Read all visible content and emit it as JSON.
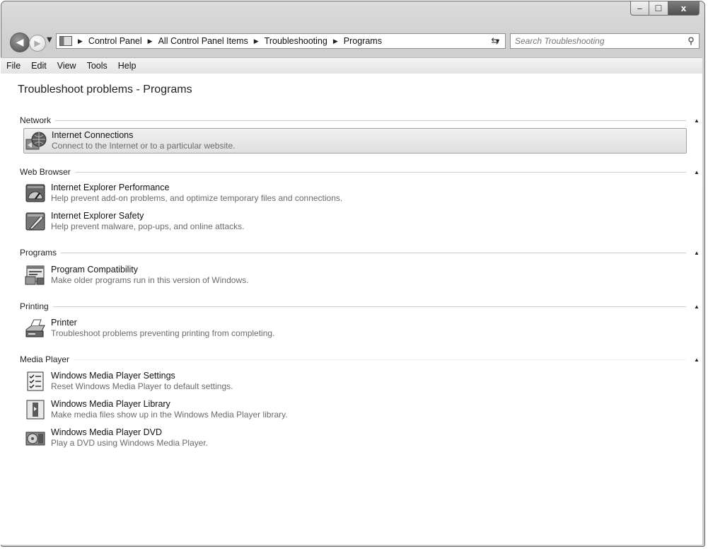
{
  "window": {
    "caption_buttons": {
      "minimize": "‒",
      "maximize": "☐",
      "close": "x"
    }
  },
  "address_bar": {
    "crumbs": [
      "Control Panel",
      "All Control Panel Items",
      "Troubleshooting",
      "Programs"
    ],
    "search_placeholder": "Search Troubleshooting"
  },
  "menu": [
    "File",
    "Edit",
    "View",
    "Tools",
    "Help"
  ],
  "page_title": "Troubleshoot problems - Programs",
  "groups": [
    {
      "name": "Network",
      "items": [
        {
          "title": "Internet Connections",
          "desc": "Connect to the Internet or to a particular website.",
          "icon": "network-globe-icon",
          "selected": true
        }
      ]
    },
    {
      "name": "Web Browser",
      "items": [
        {
          "title": "Internet Explorer Performance",
          "desc": "Help prevent add-on problems, and optimize temporary files and connections.",
          "icon": "ie-performance-icon"
        },
        {
          "title": "Internet Explorer Safety",
          "desc": "Help prevent malware, pop-ups, and online attacks.",
          "icon": "ie-safety-icon"
        }
      ]
    },
    {
      "name": "Programs",
      "items": [
        {
          "title": "Program Compatibility",
          "desc": "Make older programs run in this version of Windows.",
          "icon": "program-compat-icon"
        }
      ]
    },
    {
      "name": "Printing",
      "items": [
        {
          "title": "Printer",
          "desc": "Troubleshoot problems preventing printing from completing.",
          "icon": "printer-icon"
        }
      ]
    },
    {
      "name": "Media Player",
      "items": [
        {
          "title": "Windows Media Player Settings",
          "desc": "Reset Windows Media Player to default settings.",
          "icon": "wmp-settings-icon"
        },
        {
          "title": "Windows Media Player Library",
          "desc": "Make media files show up in the Windows Media Player library.",
          "icon": "wmp-library-icon"
        },
        {
          "title": "Windows Media Player DVD",
          "desc": "Play a DVD using Windows Media Player.",
          "icon": "wmp-dvd-icon"
        }
      ]
    }
  ]
}
